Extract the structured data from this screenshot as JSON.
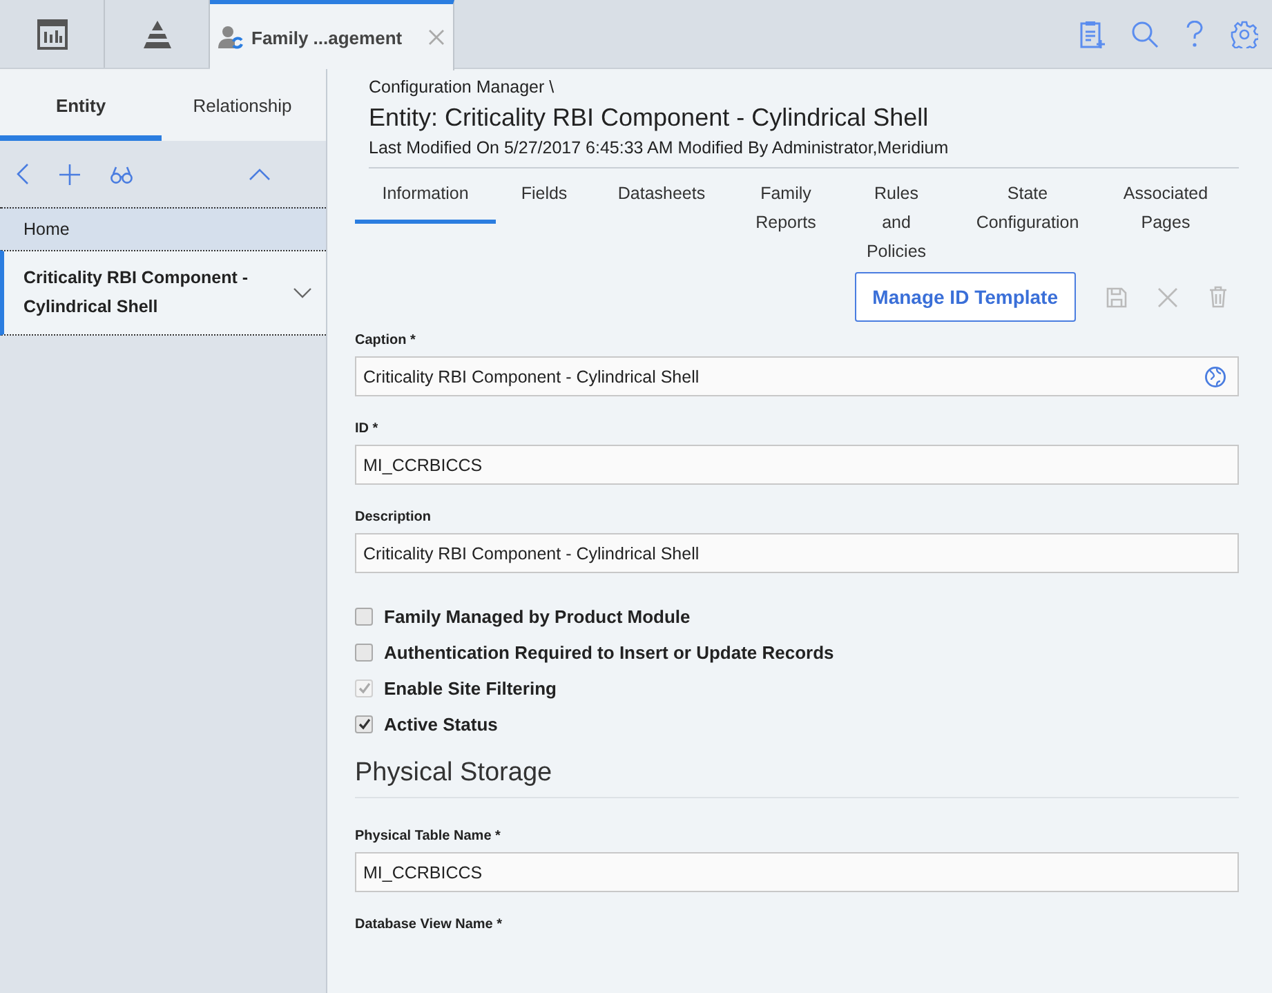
{
  "top_tabs": [
    {
      "kind": "chart",
      "selected": false
    },
    {
      "kind": "pyramid",
      "selected": false
    },
    {
      "kind": "family",
      "label": "Family ...agement",
      "selected": true
    }
  ],
  "side_tabs": [
    {
      "label": "Entity",
      "selected": true
    },
    {
      "label": "Relationship",
      "selected": false
    }
  ],
  "side_items": [
    {
      "label": "Home",
      "selected": false,
      "expandable": false
    },
    {
      "label": "Criticality RBI Component - Cylindrical Shell",
      "selected": true,
      "expandable": true
    }
  ],
  "breadcrumb": "Configuration Manager \\",
  "title": "Entity: Criticality RBI Component - Cylindrical Shell",
  "modified": "Last Modified On 5/27/2017 6:45:33 AM Modified By Administrator,Meridium",
  "tabs": [
    {
      "label": "Information",
      "selected": true
    },
    {
      "label": "Fields",
      "selected": false
    },
    {
      "label": "Datasheets",
      "selected": false
    },
    {
      "label": "Family Reports",
      "selected": false
    },
    {
      "label": "Rules and Policies",
      "selected": false
    },
    {
      "label": "State Configuration",
      "selected": false
    },
    {
      "label": "Associated Pages",
      "selected": false
    }
  ],
  "manage_button": "Manage ID Template",
  "fields": [
    {
      "kind": "text",
      "label": "Caption *",
      "value": "Criticality RBI Component - Cylindrical Shell",
      "translatable": true
    },
    {
      "kind": "text",
      "label": "ID *",
      "value": "MI_CCRBICCS",
      "translatable": false
    },
    {
      "kind": "text",
      "label": "Description",
      "value": "Criticality RBI Component - Cylindrical Shell",
      "translatable": false
    },
    {
      "kind": "checkbox",
      "label": "Family Managed by Product Module",
      "checked": false,
      "disabled": false
    },
    {
      "kind": "checkbox",
      "label": "Authentication Required to Insert or Update Records",
      "checked": false,
      "disabled": false
    },
    {
      "kind": "checkbox",
      "label": "Enable Site Filtering",
      "checked": true,
      "disabled": true
    },
    {
      "kind": "checkbox",
      "label": "Active Status",
      "checked": true,
      "disabled": false
    },
    {
      "kind": "heading",
      "label": "Physical Storage"
    },
    {
      "kind": "text",
      "label": "Physical Table Name *",
      "value": "MI_CCRBICCS",
      "translatable": false
    },
    {
      "kind": "label",
      "label": "Database View Name *"
    }
  ]
}
